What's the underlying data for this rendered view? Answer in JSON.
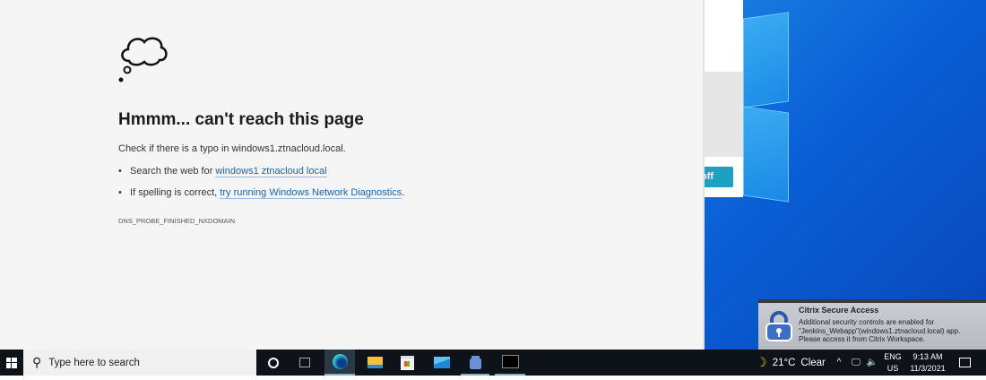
{
  "browser": {
    "title": "Hmmm... can't reach this page",
    "check_text": "Check if there is a typo in windows1.ztnacloud.local.",
    "bullet1_prefix": "Search the web for ",
    "bullet1_link": "windows1 ztnacloud local",
    "bullet2_prefix": "If spelling is correct, ",
    "bullet2_link": "try running Windows Network Diagnostics",
    "bullet2_suffix": ".",
    "error_code": "DNS_PROBE_FINISHED_NXDOMAIN",
    "icon": "thought-cloud-icon"
  },
  "background_window": {
    "button_label": "off"
  },
  "popup": {
    "title": "Citrix Secure Access",
    "line1": "Additional security controls are enabled for",
    "line2": "\"Jenkins_Webapp\"(windows1.ztnacloud.local) app.",
    "line3": "Please access it from Citrix Workspace."
  },
  "taskbar": {
    "search_placeholder": "Type here to search",
    "weather_temp": "21°C",
    "weather_cond": "Clear",
    "lang1": "ENG",
    "lang2": "US",
    "time": "9:13 AM",
    "date": "11/3/2021"
  }
}
